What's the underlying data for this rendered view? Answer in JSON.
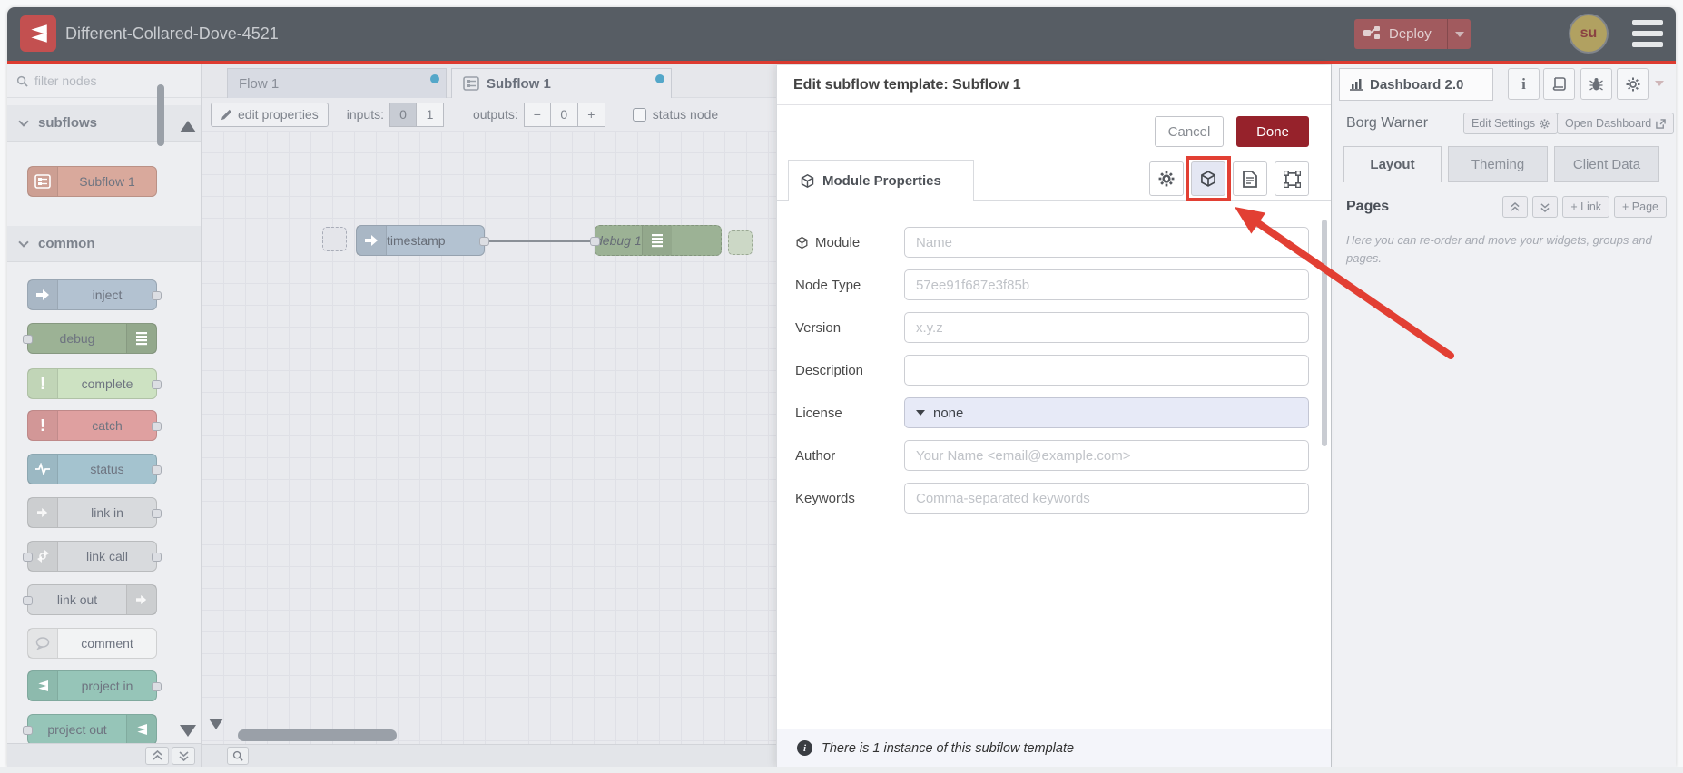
{
  "colors": {
    "header_bg": "#575d64",
    "logo_bg": "#c35050",
    "accent_red": "#dd3b30",
    "deploy_bg": "#a15a5e",
    "done_bg": "#96222b",
    "highlight_red": "#e23f33",
    "blue_dot": "#54a7c9",
    "avatar_bg": "#b1a161",
    "node_subflow": "#d9a99c",
    "node_inject": "#b3c2d1",
    "node_debug": "#9cb295",
    "node_complete": "#cde2c2",
    "node_catch": "#dfa0a0",
    "node_status": "#a4c3cf",
    "node_link": "#d8dadd",
    "node_comment": "#f2f3f4",
    "node_project": "#96c5b8"
  },
  "header": {
    "title": "Different-Collared-Dove-4521",
    "deploy_label": "Deploy",
    "avatar_text": "su"
  },
  "palette": {
    "filter_placeholder": "filter nodes",
    "categories": [
      {
        "label": "subflows",
        "nodes": [
          {
            "label": "Subflow 1"
          }
        ]
      },
      {
        "label": "common",
        "nodes": [
          {
            "label": "inject"
          },
          {
            "label": "debug"
          },
          {
            "label": "complete"
          },
          {
            "label": "catch"
          },
          {
            "label": "status"
          },
          {
            "label": "link in"
          },
          {
            "label": "link call"
          },
          {
            "label": "link out"
          },
          {
            "label": "comment"
          },
          {
            "label": "project in"
          },
          {
            "label": "project out"
          }
        ]
      }
    ]
  },
  "workspace": {
    "tabs": [
      {
        "label": "Flow 1"
      },
      {
        "label": "Subflow 1"
      }
    ],
    "toolbar": {
      "edit_properties_label": "edit properties",
      "inputs_label": "inputs:",
      "input_options": {
        "zero": "0",
        "one": "1"
      },
      "outputs_label": "outputs:",
      "outputs_minus": "−",
      "outputs_value": "0",
      "outputs_plus": "+",
      "status_node_label": "status node"
    },
    "nodes": {
      "inject_label": "timestamp",
      "debug_label": "debug 1"
    }
  },
  "dialog": {
    "title": "Edit subflow template: Subflow 1",
    "cancel_label": "Cancel",
    "done_label": "Done",
    "tab_label": "Module Properties",
    "fields": [
      {
        "label": "Module",
        "placeholder": "Name"
      },
      {
        "label": "Node Type",
        "placeholder": "57ee91f687e3f85b"
      },
      {
        "label": "Version",
        "placeholder": "x.y.z"
      },
      {
        "label": "Description",
        "placeholder": ""
      },
      {
        "label": "License",
        "value": "none"
      },
      {
        "label": "Author",
        "placeholder": "Your Name <email@example.com>"
      },
      {
        "label": "Keywords",
        "placeholder": "Comma-separated keywords"
      }
    ],
    "footer_text": "There is 1 instance of this subflow template"
  },
  "sidebar": {
    "tab_label": "Dashboard 2.0",
    "dashboard_name": "Borg Warner",
    "edit_settings_label": "Edit Settings",
    "open_dashboard_label": "Open Dashboard",
    "tabs": [
      {
        "label": "Layout"
      },
      {
        "label": "Theming"
      },
      {
        "label": "Client Data"
      }
    ],
    "pages_title": "Pages",
    "link_button": "+ Link",
    "page_button": "+ Page",
    "help_text": "Here you can re-order and move your widgets, groups and pages."
  }
}
